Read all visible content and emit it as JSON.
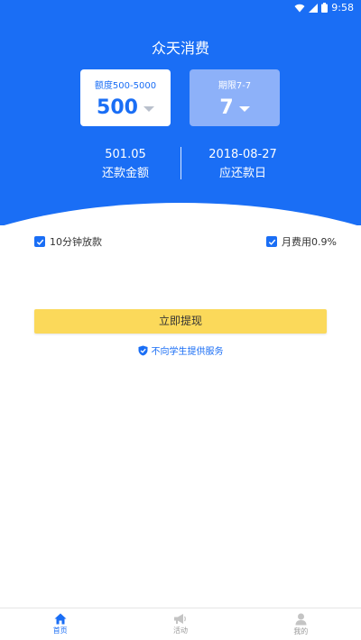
{
  "status_bar": {
    "time": "9:58",
    "icons": [
      "wifi-icon",
      "signal-icon",
      "battery-icon"
    ]
  },
  "header": {
    "title": "众天消费"
  },
  "amount_card": {
    "label": "额度500-5000",
    "value": "500"
  },
  "term_card": {
    "label": "期限7-7",
    "value": "7"
  },
  "repay_amount": {
    "value": "501.05",
    "label": "还款金额"
  },
  "repay_date": {
    "value": "2018-08-27",
    "label": "应还款日"
  },
  "options": {
    "fast_loan": {
      "label": "10分钟放款",
      "checked": true
    },
    "monthly_fee": {
      "label": "月费用0.9%",
      "checked": true
    }
  },
  "withdraw_button": {
    "label": "立即提现"
  },
  "notice": {
    "text": "不向学生提供服务",
    "icon": "shield-check-icon"
  },
  "tabs": [
    {
      "label": "首页",
      "icon": "home-icon",
      "active": true
    },
    {
      "label": "活动",
      "icon": "megaphone-icon",
      "active": false
    },
    {
      "label": "我的",
      "icon": "user-icon",
      "active": false
    }
  ],
  "colors": {
    "primary": "#1a6ef5",
    "button": "#fbd95a",
    "term_card": "#8db1f9"
  }
}
